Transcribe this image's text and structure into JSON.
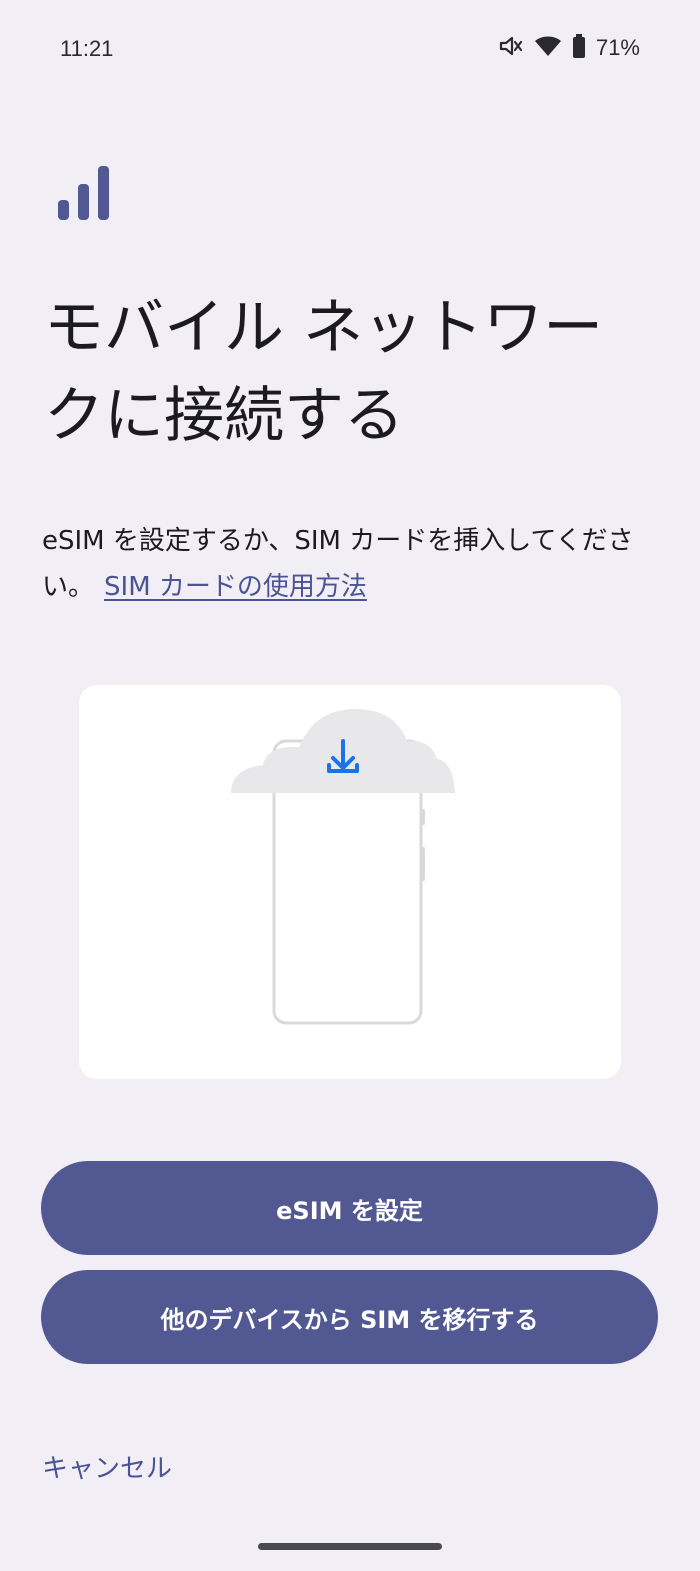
{
  "status_bar": {
    "time": "11:21",
    "battery_percent": "71%",
    "icons": [
      "mute-icon",
      "wifi-icon",
      "battery-icon"
    ]
  },
  "header_icon": "signal-bars-icon",
  "title": "モバイル ネットワークに接続する",
  "description": {
    "text": "eSIM を設定するか、SIM カードを挿入してください。",
    "link": "SIM カードの使用方法"
  },
  "illustration": {
    "icons": [
      "cloud-download-icon",
      "phone-outline-icon"
    ]
  },
  "buttons": {
    "setup_esim": "eSIM を設定",
    "transfer_sim": "他のデバイスから SIM を移行する"
  },
  "cancel_label": "キャンセル",
  "colors": {
    "background": "#F1EEF6",
    "primary": "#525992",
    "link": "#4A5494",
    "accent_blue": "#1A73E8"
  }
}
